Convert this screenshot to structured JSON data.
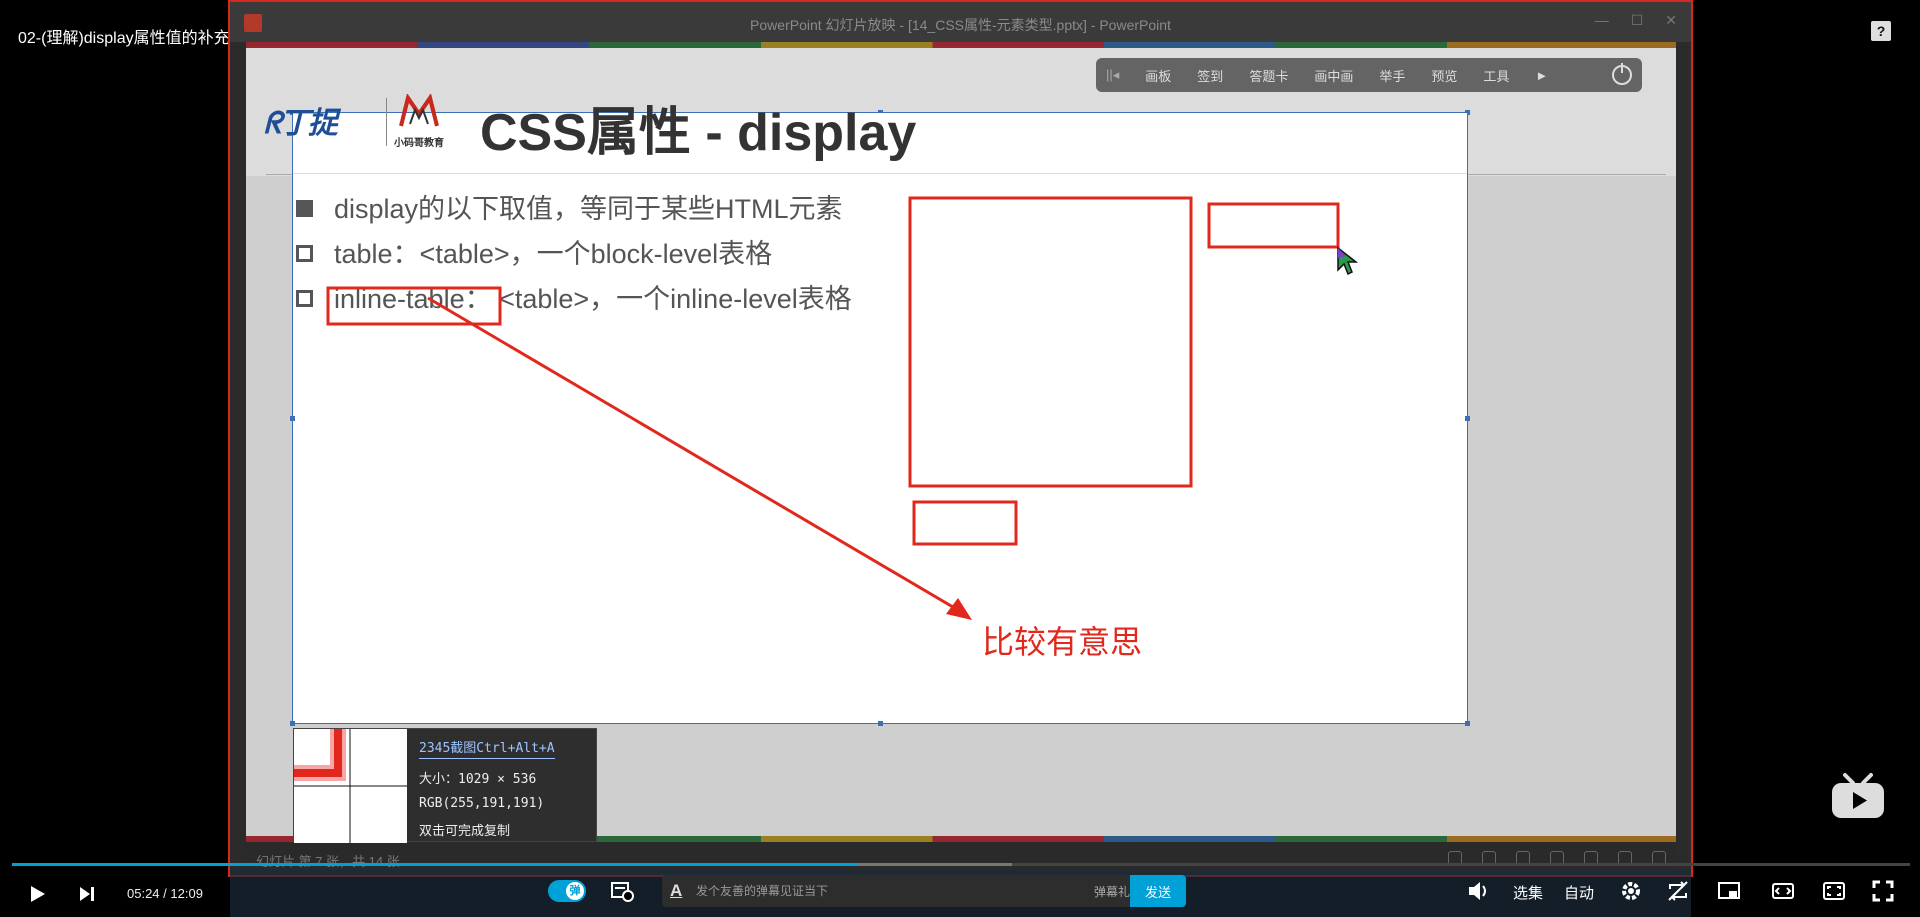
{
  "video": {
    "title": "02-(理解)display属性值的补充",
    "help_icon": "?"
  },
  "powerpoint": {
    "window_title": "PowerPoint 幻灯片放映 - [14_CSS属性-元素类型.pptx] - PowerPoint",
    "toolbar": [
      "画板",
      "签到",
      "答题卡",
      "画中画",
      "举手",
      "预览",
      "工具"
    ],
    "slide_title": "CSS属性 - display",
    "logo_text": "小码哥教育",
    "bullets": [
      "display的以下取值，等同于某些HTML元素",
      "table：<table>，一个block-level表格",
      "inline-table：  <table>，一个inline-level表格"
    ],
    "annotation": "比较有意思",
    "status": "幻灯片 第 7 张，共 14 张",
    "annotation_color": "#e2281c"
  },
  "snip_tool": {
    "header": "2345截图Ctrl+Alt+A",
    "size": "大小：1029 × 536",
    "rgb": "RGB(255,191,191)",
    "hint": "双击可完成复制"
  },
  "player": {
    "current_time": "05:24",
    "separator": "/",
    "duration": "12:09",
    "progress_fraction": 0.445,
    "danmu_toggle_label": "弹",
    "danmu_placeholder": "发个友善的弹幕见证当下",
    "danmu_etiquette": "弹幕礼仪 ›",
    "send_label": "发送",
    "episodes_label": "选集",
    "quality_label": "自动",
    "accent_color": "#00a1d6"
  }
}
